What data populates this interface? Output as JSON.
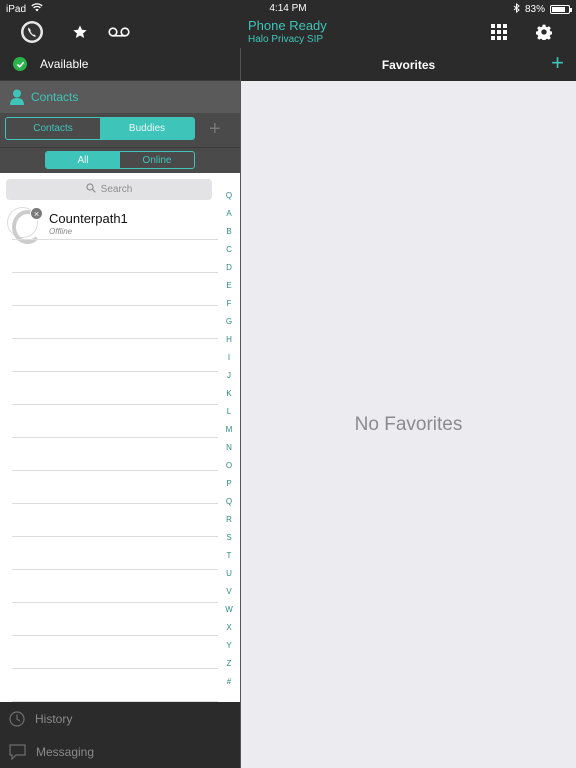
{
  "status_bar": {
    "device": "iPad",
    "time": "4:14 PM",
    "battery": "83%",
    "battery_level": 0.83
  },
  "toolbar": {
    "phone_status_title": "Phone Ready",
    "phone_status_subtitle": "Halo Privacy SIP",
    "icons": [
      "phone-logo-icon",
      "star-icon",
      "voicemail-icon",
      "dialpad-icon",
      "gear-icon"
    ]
  },
  "availability": {
    "label": "Available",
    "color": "#2bb24c"
  },
  "contacts": {
    "title": "Contacts",
    "segment_primary": [
      {
        "label": "Contacts",
        "active": false
      },
      {
        "label": "Buddies",
        "active": true
      }
    ],
    "segment_filter": [
      {
        "label": "All",
        "active": true
      },
      {
        "label": "Online",
        "active": false
      }
    ],
    "search_placeholder": "Search",
    "items": [
      {
        "name": "Counterpath1",
        "status": "Offline"
      }
    ],
    "index": [
      "Q",
      "A",
      "B",
      "C",
      "D",
      "E",
      "F",
      "G",
      "H",
      "I",
      "J",
      "K",
      "L",
      "M",
      "N",
      "O",
      "P",
      "Q",
      "R",
      "S",
      "T",
      "U",
      "V",
      "W",
      "X",
      "Y",
      "Z",
      "#"
    ]
  },
  "bottom_nav": [
    {
      "label": "History",
      "icon": "clock-icon"
    },
    {
      "label": "Messaging",
      "icon": "chat-bubble-icon"
    }
  ],
  "favorites": {
    "title": "Favorites",
    "empty_text": "No Favorites"
  },
  "colors": {
    "accent": "#3fc4b9",
    "bar_bg": "#2b2b2b",
    "favorites_bg": "#ebebf0"
  }
}
